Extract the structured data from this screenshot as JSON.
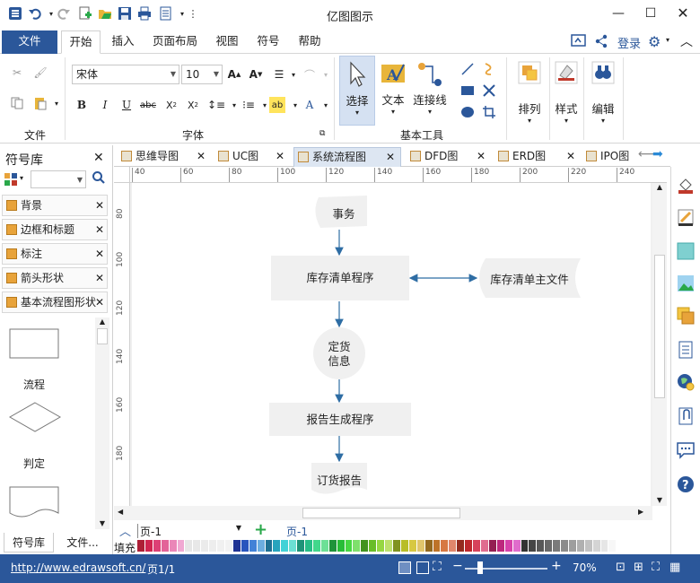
{
  "app": {
    "title": "亿图图示",
    "window_controls": [
      "minimize-icon",
      "maximize-icon",
      "close-icon"
    ]
  },
  "quick_access": [
    "app-logo-icon",
    "undo-icon",
    "redo-icon",
    "new-icon",
    "open-icon",
    "save-icon",
    "print-icon",
    "export-icon",
    "customize-icon"
  ],
  "menu": {
    "file": "文件",
    "tabs": [
      "开始",
      "插入",
      "页面布局",
      "视图",
      "符号",
      "帮助"
    ],
    "active": "开始",
    "login": "登录"
  },
  "ribbon": {
    "groups": {
      "file": "文件",
      "font": "字体",
      "basic_tools": "基本工具"
    },
    "font_name": "宋体",
    "font_size": "10",
    "tools": {
      "select": "选择",
      "text": "文本",
      "connector": "连接线"
    },
    "arrange": "排列",
    "style": "样式",
    "edit": "编辑"
  },
  "symbol_panel": {
    "title": "符号库",
    "libraries": [
      "背景",
      "边框和标题",
      "标注",
      "箭头形状",
      "基本流程图形状"
    ],
    "shapes": [
      "流程",
      "判定",
      ""
    ],
    "bottom_tabs": [
      "符号库",
      "文件..."
    ]
  },
  "doc_tabs": [
    {
      "label": "思维导图",
      "active": false
    },
    {
      "label": "UC图",
      "active": false
    },
    {
      "label": "系统流程图",
      "active": true
    },
    {
      "label": "DFD图",
      "active": false
    },
    {
      "label": "ERD图",
      "active": false
    },
    {
      "label": "IPO图",
      "active": false
    }
  ],
  "rulers": {
    "h_ticks": [
      "40",
      "60",
      "80",
      "100",
      "120",
      "140",
      "160",
      "180",
      "200",
      "220",
      "240"
    ],
    "v_ticks": [
      "80",
      "100",
      "120",
      "140",
      "160",
      "180"
    ]
  },
  "diagram": {
    "nodes": {
      "event": "事务",
      "inventory_process": "库存清单程序",
      "inventory_master": "库存清单主文件",
      "order_info_line1": "定货",
      "order_info_line2": "信息",
      "report_process": "报告生成程序",
      "order_report": "订货报告"
    }
  },
  "page_bar": {
    "page_select": "页-1",
    "current_page": "页-1",
    "fill_label": "填充"
  },
  "status": {
    "url": "http://www.edrawsoft.cn/",
    "page_info": "页1/1",
    "zoom": "70%"
  },
  "colors": {
    "accent": "#2b579a",
    "shape_fill": "#f0f0f0",
    "connector": "#2e6da4"
  }
}
